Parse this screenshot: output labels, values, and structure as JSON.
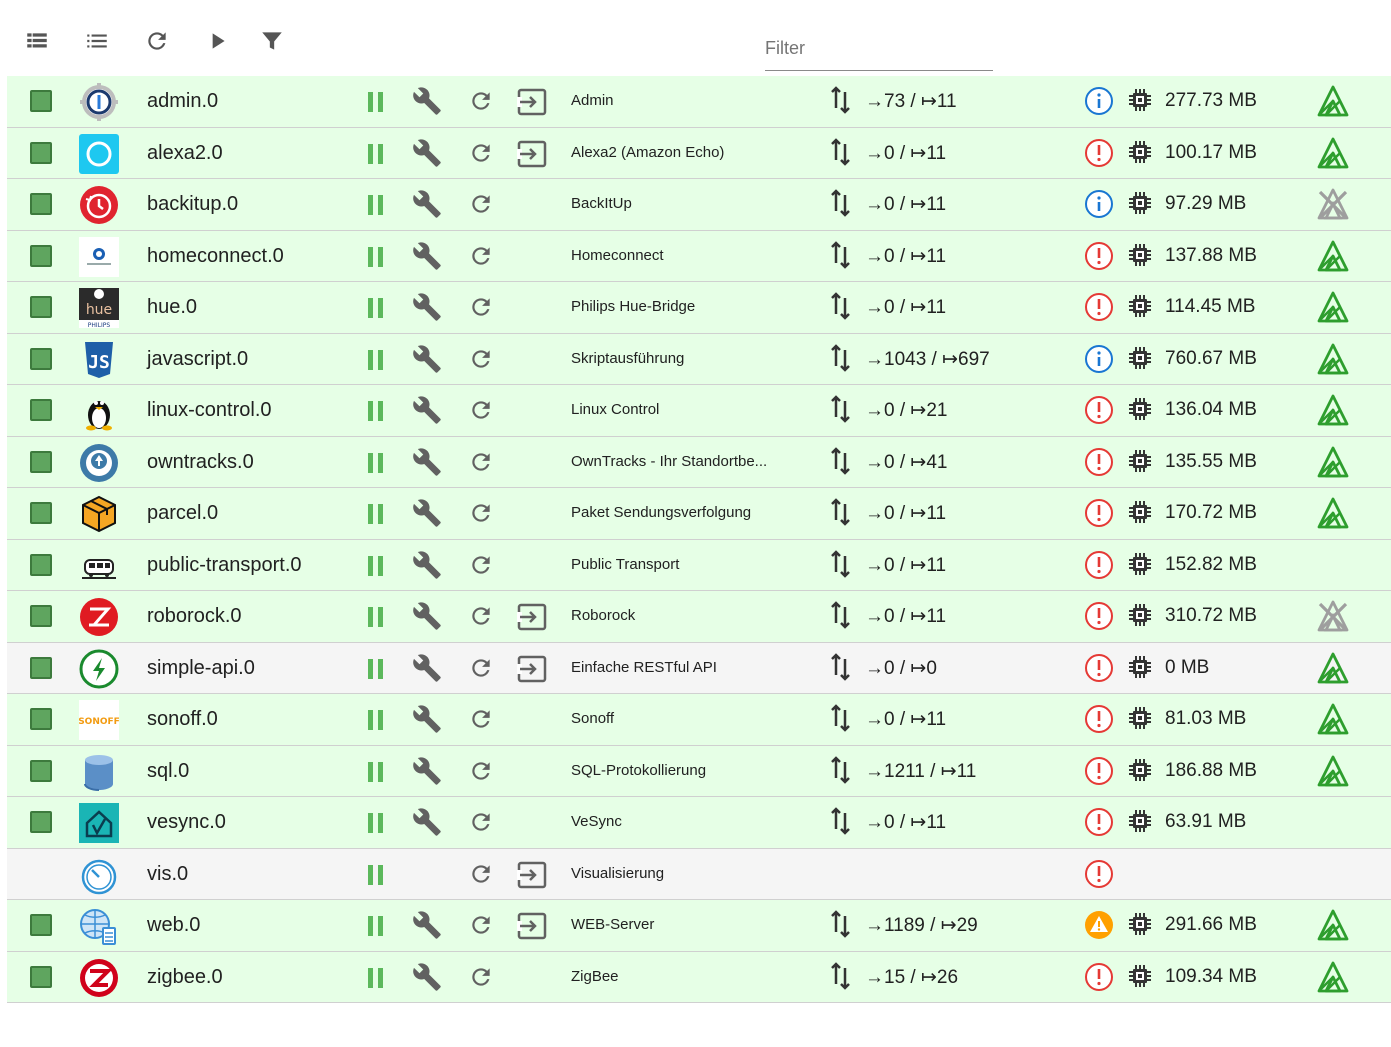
{
  "toolbar": {
    "filter_placeholder": "Filter",
    "buttons": [
      "view-list-icon",
      "view-compact-list-icon",
      "refresh-icon",
      "play-icon",
      "filter-icon"
    ]
  },
  "colors": {
    "row_green": "#e6ffe6",
    "row_grey": "#f5f5f5",
    "pause_green": "#5cb85c",
    "tier_green": "#2e9e2e",
    "info_blue": "#1976d2",
    "error_red": "#e53935",
    "warn_orange": "#ffa000"
  },
  "adapters": [
    {
      "name": "admin.0",
      "title": "Admin",
      "events": "→73 / ↦11",
      "memory": "277.73 MB",
      "status": "info",
      "logo": "admin-logo-icon",
      "row": "green",
      "has_open": true,
      "has_config": true,
      "has_checkbox": true,
      "has_conn": true,
      "tier": "green"
    },
    {
      "name": "alexa2.0",
      "title": "Alexa2 (Amazon Echo)",
      "events": "→0 / ↦11",
      "memory": "100.17 MB",
      "status": "error",
      "logo": "alexa-logo-icon",
      "row": "green",
      "has_open": true,
      "has_config": true,
      "has_checkbox": true,
      "has_conn": true,
      "tier": "green"
    },
    {
      "name": "backitup.0",
      "title": "BackItUp",
      "events": "→0 / ↦11",
      "memory": "97.29 MB",
      "status": "info",
      "logo": "backitup-logo-icon",
      "row": "green",
      "has_open": false,
      "has_config": true,
      "has_checkbox": true,
      "has_conn": true,
      "tier": "grey"
    },
    {
      "name": "homeconnect.0",
      "title": "Homeconnect",
      "events": "→0 / ↦11",
      "memory": "137.88 MB",
      "status": "error",
      "logo": "homeconnect-logo-icon",
      "row": "green",
      "has_open": false,
      "has_config": true,
      "has_checkbox": true,
      "has_conn": true,
      "tier": "green"
    },
    {
      "name": "hue.0",
      "title": "Philips Hue-Bridge",
      "events": "→0 / ↦11",
      "memory": "114.45 MB",
      "status": "error",
      "logo": "hue-logo-icon",
      "row": "green",
      "has_open": false,
      "has_config": true,
      "has_checkbox": true,
      "has_conn": true,
      "tier": "green"
    },
    {
      "name": "javascript.0",
      "title": "Skriptausführung",
      "events": "→1043 / ↦697",
      "memory": "760.67 MB",
      "status": "info",
      "logo": "javascript-logo-icon",
      "row": "green",
      "has_open": false,
      "has_config": true,
      "has_checkbox": true,
      "has_conn": true,
      "tier": "green"
    },
    {
      "name": "linux-control.0",
      "title": "Linux Control",
      "events": "→0 / ↦21",
      "memory": "136.04 MB",
      "status": "error",
      "logo": "linux-logo-icon",
      "row": "green",
      "has_open": false,
      "has_config": true,
      "has_checkbox": true,
      "has_conn": true,
      "tier": "green"
    },
    {
      "name": "owntracks.0",
      "title": "OwnTracks - Ihr Standortbe...",
      "events": "→0 / ↦41",
      "memory": "135.55 MB",
      "status": "error",
      "logo": "owntracks-logo-icon",
      "row": "green",
      "has_open": false,
      "has_config": true,
      "has_checkbox": true,
      "has_conn": true,
      "tier": "green"
    },
    {
      "name": "parcel.0",
      "title": "Paket Sendungsverfolgung",
      "events": "→0 / ↦11",
      "memory": "170.72 MB",
      "status": "error",
      "logo": "parcel-logo-icon",
      "row": "green",
      "has_open": false,
      "has_config": true,
      "has_checkbox": true,
      "has_conn": true,
      "tier": "green"
    },
    {
      "name": "public-transport.0",
      "title": "Public Transport",
      "events": "→0 / ↦11",
      "memory": "152.82 MB",
      "status": "error",
      "logo": "train-logo-icon",
      "row": "green",
      "has_open": false,
      "has_config": true,
      "has_checkbox": true,
      "has_conn": true,
      "tier": "none"
    },
    {
      "name": "roborock.0",
      "title": "Roborock",
      "events": "→0 / ↦11",
      "memory": "310.72 MB",
      "status": "error",
      "logo": "roborock-logo-icon",
      "row": "green",
      "has_open": true,
      "has_config": true,
      "has_checkbox": true,
      "has_conn": true,
      "tier": "grey"
    },
    {
      "name": "simple-api.0",
      "title": "Einfache RESTful API",
      "events": "→0 / ↦0",
      "memory": "0 MB",
      "status": "error",
      "logo": "simple-api-logo-icon",
      "row": "grey",
      "has_open": true,
      "has_config": true,
      "has_checkbox": true,
      "has_conn": true,
      "tier": "green"
    },
    {
      "name": "sonoff.0",
      "title": "Sonoff",
      "events": "→0 / ↦11",
      "memory": "81.03 MB",
      "status": "error",
      "logo": "sonoff-logo-icon",
      "row": "green",
      "has_open": false,
      "has_config": true,
      "has_checkbox": true,
      "has_conn": true,
      "tier": "green"
    },
    {
      "name": "sql.0",
      "title": "SQL-Protokollierung",
      "events": "→1211 / ↦11",
      "memory": "186.88 MB",
      "status": "error",
      "logo": "sql-logo-icon",
      "row": "green",
      "has_open": false,
      "has_config": true,
      "has_checkbox": true,
      "has_conn": true,
      "tier": "green"
    },
    {
      "name": "vesync.0",
      "title": "VeSync",
      "events": "→0 / ↦11",
      "memory": "63.91 MB",
      "status": "error",
      "logo": "vesync-logo-icon",
      "row": "green",
      "has_open": false,
      "has_config": true,
      "has_checkbox": true,
      "has_conn": true,
      "tier": "none"
    },
    {
      "name": "vis.0",
      "title": "Visualisierung",
      "events": "",
      "memory": "",
      "status": "error",
      "logo": "vis-logo-icon",
      "row": "grey",
      "has_open": true,
      "has_config": false,
      "has_checkbox": false,
      "has_conn": false,
      "tier": "none"
    },
    {
      "name": "web.0",
      "title": "WEB-Server",
      "events": "→1189 / ↦29",
      "memory": "291.66 MB",
      "status": "warn",
      "logo": "web-logo-icon",
      "row": "green",
      "has_open": true,
      "has_config": true,
      "has_checkbox": true,
      "has_conn": true,
      "tier": "green"
    },
    {
      "name": "zigbee.0",
      "title": "ZigBee",
      "events": "→15 / ↦26",
      "memory": "109.34 MB",
      "status": "error",
      "logo": "zigbee-logo-icon",
      "row": "green",
      "has_open": false,
      "has_config": true,
      "has_checkbox": true,
      "has_conn": true,
      "tier": "green"
    }
  ]
}
